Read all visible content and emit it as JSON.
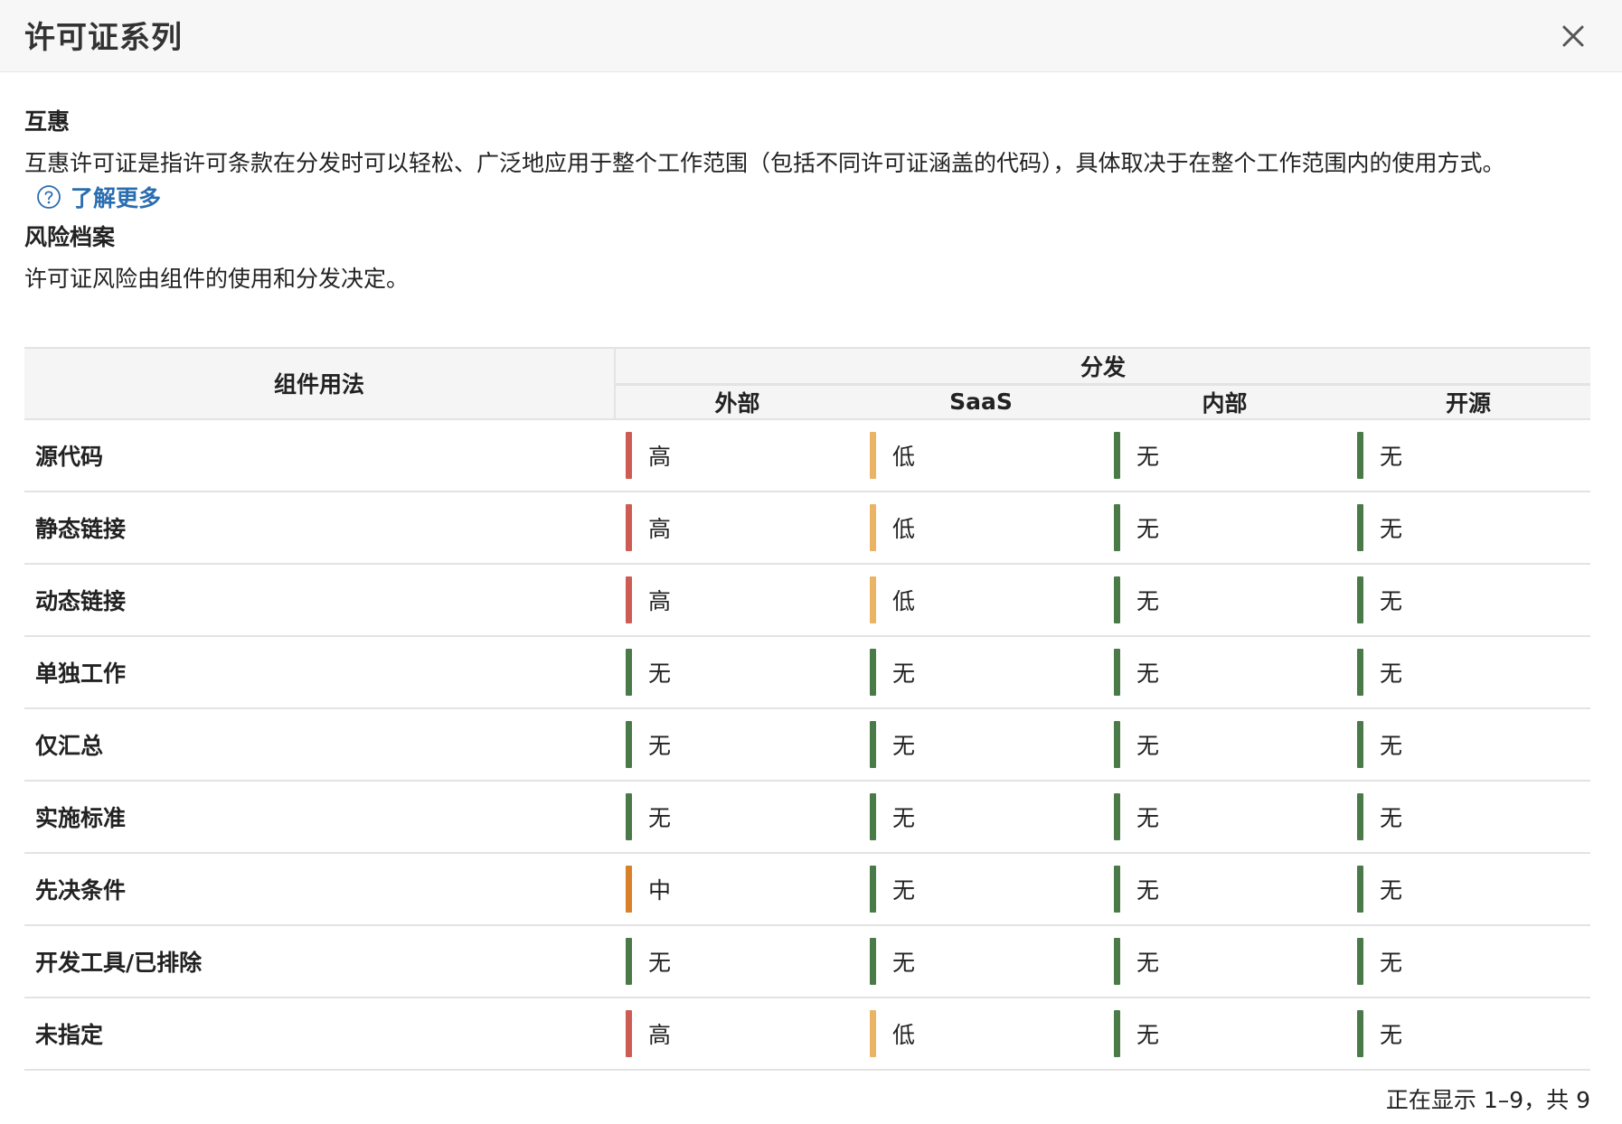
{
  "dialog": {
    "title": "许可证系列",
    "close_icon": "close-icon"
  },
  "reciprocal": {
    "heading": "互惠",
    "text": "互惠许可证是指许可条款在分发时可以轻松、广泛地应用于整个工作范围（包括不同许可证涵盖的代码），具体取决于在整个工作范围内的使用方式。",
    "learn_more": "了解更多",
    "learn_more_icon": "question-circle-icon"
  },
  "risk_profile": {
    "heading": "风险档案",
    "text": "许可证风险由组件的使用和分发决定。"
  },
  "table": {
    "usage_header": "组件用法",
    "distribution_header": "分发",
    "columns": [
      "外部",
      "SaaS",
      "内部",
      "开源"
    ],
    "rows": [
      {
        "label": "源代码",
        "values": [
          "高",
          "低",
          "无",
          "无"
        ]
      },
      {
        "label": "静态链接",
        "values": [
          "高",
          "低",
          "无",
          "无"
        ]
      },
      {
        "label": "动态链接",
        "values": [
          "高",
          "低",
          "无",
          "无"
        ]
      },
      {
        "label": "单独工作",
        "values": [
          "无",
          "无",
          "无",
          "无"
        ]
      },
      {
        "label": "仅汇总",
        "values": [
          "无",
          "无",
          "无",
          "无"
        ]
      },
      {
        "label": "实施标准",
        "values": [
          "无",
          "无",
          "无",
          "无"
        ]
      },
      {
        "label": "先决条件",
        "values": [
          "中",
          "无",
          "无",
          "无"
        ]
      },
      {
        "label": "开发工具/已排除",
        "values": [
          "无",
          "无",
          "无",
          "无"
        ]
      },
      {
        "label": "未指定",
        "values": [
          "高",
          "低",
          "无",
          "无"
        ]
      }
    ]
  },
  "risk_colors": {
    "高": "#cd5c55",
    "中": "#d8802a",
    "低": "#eab464",
    "无": "#4a7a47"
  },
  "footer": {
    "count": "正在显示 1–9，共 9"
  }
}
